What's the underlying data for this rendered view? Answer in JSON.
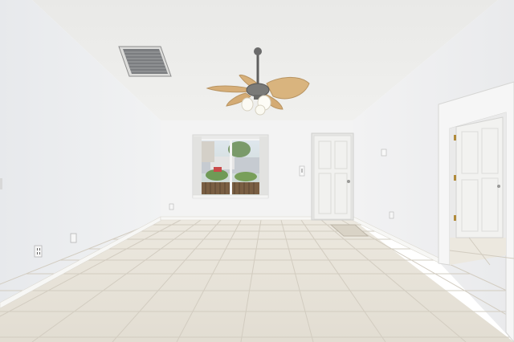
{
  "scene": {
    "colors": {
      "ceiling": "#eeeeec",
      "back_wall": "#f3f3f3",
      "left_wall": "#ecedee",
      "right_wall": "#eeeff0",
      "floor_tile": "#e7e2d8",
      "grout": "#cdc7bb",
      "baseboard": "#f6f6f4",
      "door": "#f1f1ef",
      "fan_blade": "#d9b47e",
      "fan_metal": "#6b6b6b",
      "window_frame": "#f2f2f2"
    },
    "icons": [
      "ceiling-fan-icon",
      "air-vent-icon",
      "power-outlet-icon",
      "light-switch-icon",
      "door-knob-icon"
    ]
  }
}
